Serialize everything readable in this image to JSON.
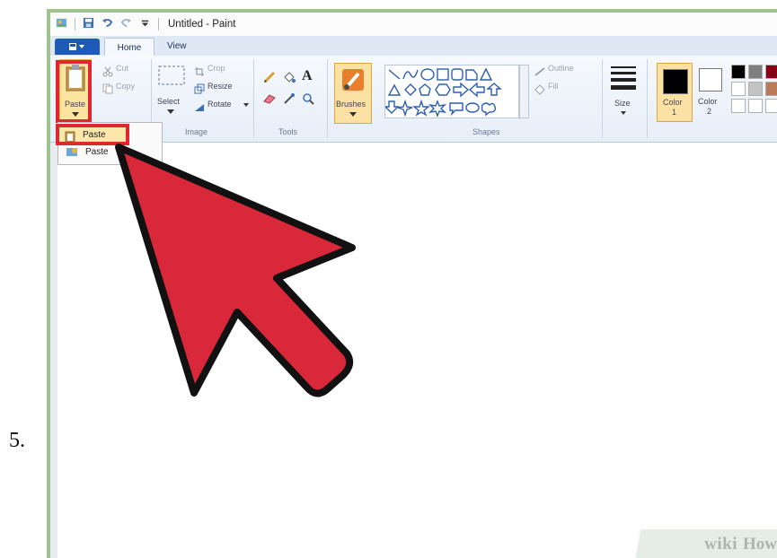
{
  "step_number": "5.",
  "window": {
    "title": "Untitled - Paint"
  },
  "tabs": {
    "home": "Home",
    "view": "View"
  },
  "clipboard": {
    "paste": "Paste",
    "cut": "Cut",
    "copy": "Copy"
  },
  "image": {
    "select": "Select",
    "crop": "Crop",
    "resize": "Resize",
    "rotate": "Rotate",
    "label": "Image"
  },
  "tools": {
    "label": "Tools"
  },
  "brushes": {
    "label": "Brushes"
  },
  "shapes": {
    "outline": "Outline",
    "fill": "Fill",
    "label": "Shapes"
  },
  "size": {
    "label": "Size"
  },
  "colors": {
    "color1_label": "Color",
    "color1_num": "1",
    "color2_label": "Color",
    "color2_num": "2",
    "swatches_row1": [
      "#000000",
      "#7f7f7f",
      "#880015"
    ],
    "swatches_row2": [
      "#ffffff",
      "#c3c3c3",
      "#b97a57"
    ]
  },
  "paste_menu": {
    "item1": "Paste",
    "item2": "Paste"
  },
  "watermark": {
    "wiki": "wiki",
    "how": "How"
  },
  "accent_colors": {
    "highlight_red": "#e0262f",
    "arrow_red": "#d9283a"
  }
}
